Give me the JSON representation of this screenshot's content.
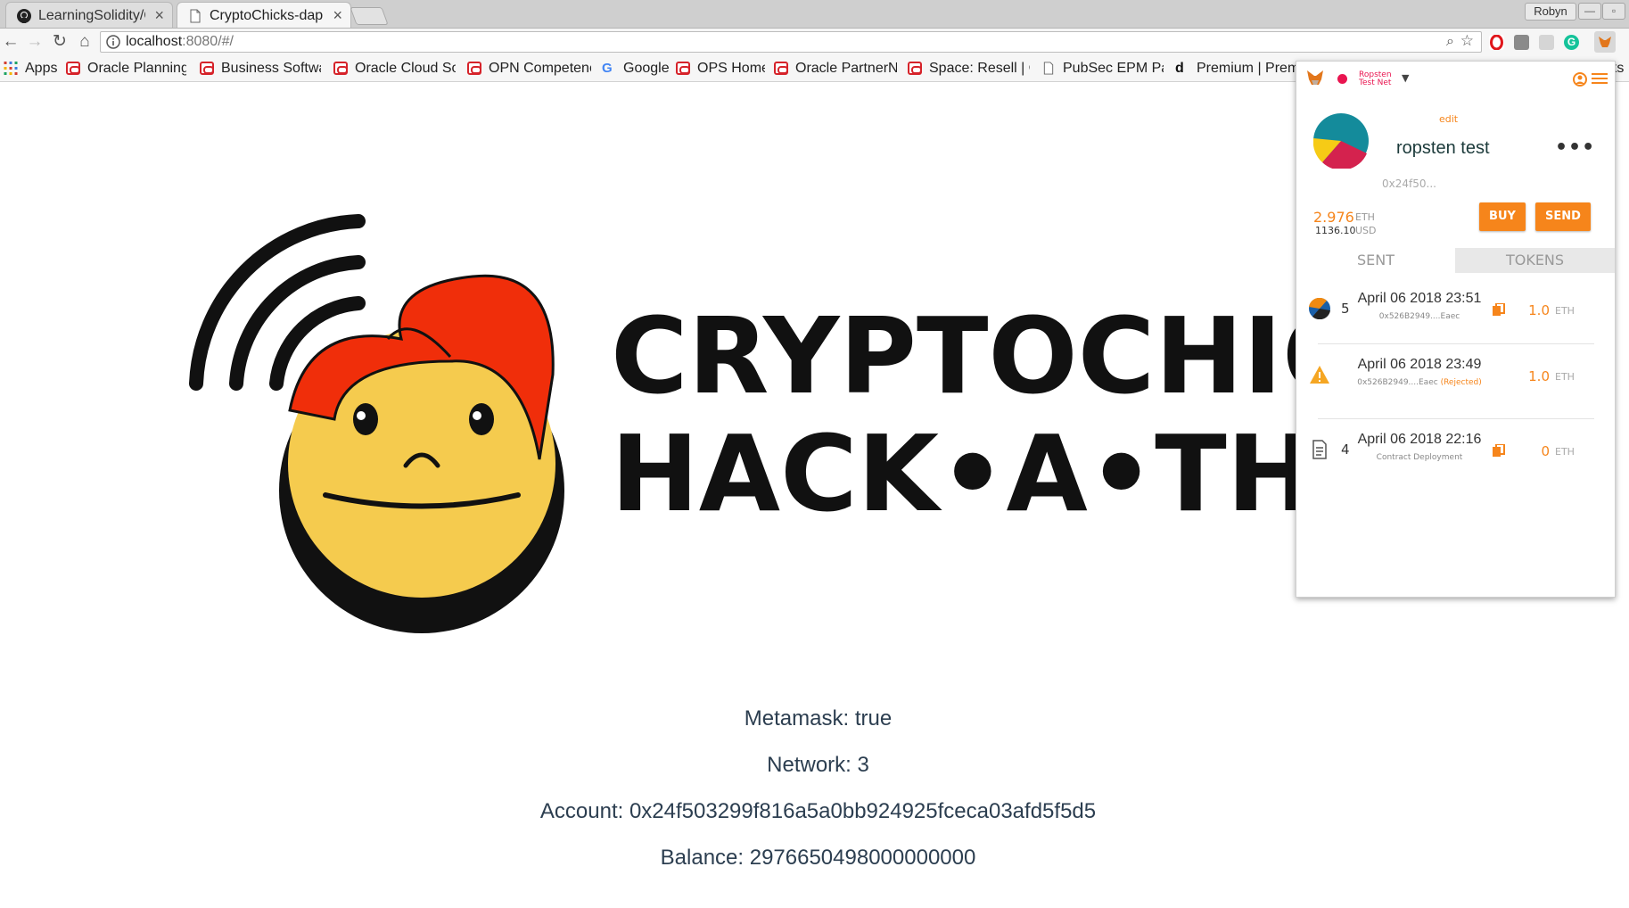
{
  "browser": {
    "tabs": [
      {
        "label": "LearningSolidity/Cr",
        "icon": "github-icon"
      },
      {
        "label": "CryptoChicks-dapp",
        "icon": "document-icon"
      }
    ],
    "profile_name": "Robyn",
    "url_host": "localhost",
    "url_rest": ":8080/#/"
  },
  "bookmarks": [
    {
      "label": "Apps",
      "icon": "apps-grid-icon"
    },
    {
      "label": "Oracle Planning",
      "icon": "oracle-icon"
    },
    {
      "label": "Business Softwa",
      "icon": "oracle-icon"
    },
    {
      "label": "Oracle Cloud Sol",
      "icon": "oracle-icon"
    },
    {
      "label": "OPN Competenc",
      "icon": "oracle-icon"
    },
    {
      "label": "Google",
      "icon": "google-icon"
    },
    {
      "label": "OPS Home",
      "icon": "oracle-icon"
    },
    {
      "label": "Oracle PartnerN",
      "icon": "oracle-icon"
    },
    {
      "label": "Space: Resell | Or",
      "icon": "oracle-icon"
    },
    {
      "label": "PubSec EPM Par",
      "icon": "document-icon"
    },
    {
      "label": "Premium | Premi",
      "icon": "d-icon"
    },
    {
      "label": "rks",
      "icon": ""
    }
  ],
  "page": {
    "logo_line1": "CRYPTOCHICKS",
    "logo_line2": "HACK•A•THON",
    "metamask": "Metamask: true",
    "network": "Network: 3",
    "account": "Account: 0x24f503299f816a5a0bb924925fceca03afd5f5d5",
    "balance": "Balance: 2976650498000000000"
  },
  "metamask": {
    "network_line1": "Ropsten",
    "network_line2": "Test Net",
    "edit_label": "edit",
    "account_name": "ropsten test",
    "address_short": "0x24f50...",
    "eth_balance": "2.976",
    "eth_unit": "ETH",
    "usd_balance": "1136.10",
    "usd_unit": "USD",
    "buy_label": "BUY",
    "send_label": "SEND",
    "tab_sent": "SENT",
    "tab_tokens": "TOKENS",
    "transactions": [
      {
        "nonce": "5",
        "date": "April 06 2018 23:51",
        "sub": "0x526B2949....Eaec",
        "status": "",
        "amount": "1.0",
        "unit": "ETH",
        "icon": "identicon-icon"
      },
      {
        "nonce": "",
        "date": "April 06 2018 23:49",
        "sub": "0x526B2949....Eaec",
        "status": "(Rejected)",
        "amount": "1.0",
        "unit": "ETH",
        "icon": "warning-icon"
      },
      {
        "nonce": "4",
        "date": "April 06 2018 22:16",
        "sub": "Contract Deployment",
        "status": "",
        "amount": "0",
        "unit": "ETH",
        "icon": "document-icon"
      }
    ]
  },
  "colors": {
    "metamask_orange": "#f6851b",
    "network_pink": "#e91550",
    "text_dark": "#2c3e50"
  }
}
